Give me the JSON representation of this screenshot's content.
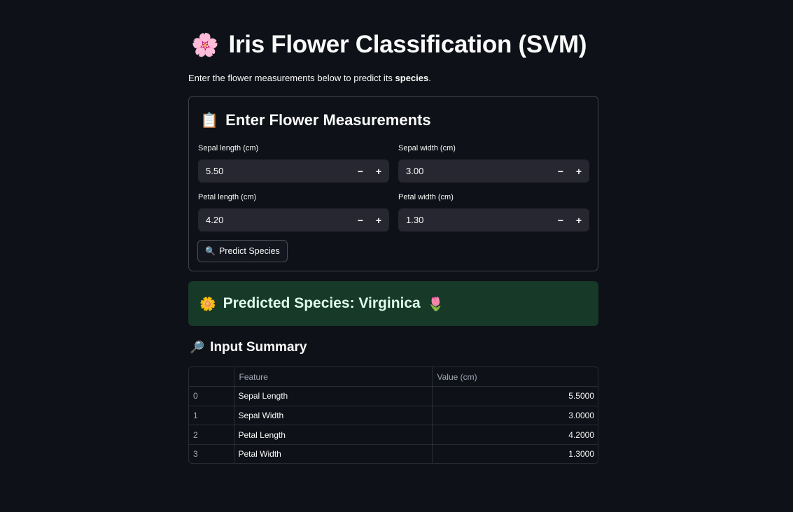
{
  "header": {
    "title_emoji": "🌸",
    "title": "Iris Flower Classification (SVM)",
    "subtitle_prefix": "Enter the flower measurements below to predict its ",
    "subtitle_bold": "species",
    "subtitle_suffix": "."
  },
  "form": {
    "title_emoji": "📋",
    "title": "Enter Flower Measurements",
    "fields": [
      {
        "label": "Sepal length (cm)",
        "value": "5.50"
      },
      {
        "label": "Sepal width (cm)",
        "value": "3.00"
      },
      {
        "label": "Petal length (cm)",
        "value": "4.20"
      },
      {
        "label": "Petal width (cm)",
        "value": "1.30"
      }
    ],
    "decrement_label": "−",
    "increment_label": "+",
    "predict_emoji": "🔍",
    "predict_label": "Predict Species"
  },
  "result": {
    "emoji_left": "🌼",
    "text": "Predicted Species: Virginica",
    "emoji_right": "🌷"
  },
  "summary": {
    "emoji": "🔎",
    "heading": "Input Summary",
    "columns": [
      "",
      "Feature",
      "Value (cm)"
    ],
    "rows": [
      {
        "index": "0",
        "feature": "Sepal Length",
        "value": "5.5000"
      },
      {
        "index": "1",
        "feature": "Sepal Width",
        "value": "3.0000"
      },
      {
        "index": "2",
        "feature": "Petal Length",
        "value": "4.2000"
      },
      {
        "index": "3",
        "feature": "Petal Width",
        "value": "1.3000"
      }
    ]
  },
  "colors": {
    "background": "#0e1117",
    "input_bg": "#262730",
    "success_bg": "#173928",
    "success_text": "#dffde9"
  }
}
